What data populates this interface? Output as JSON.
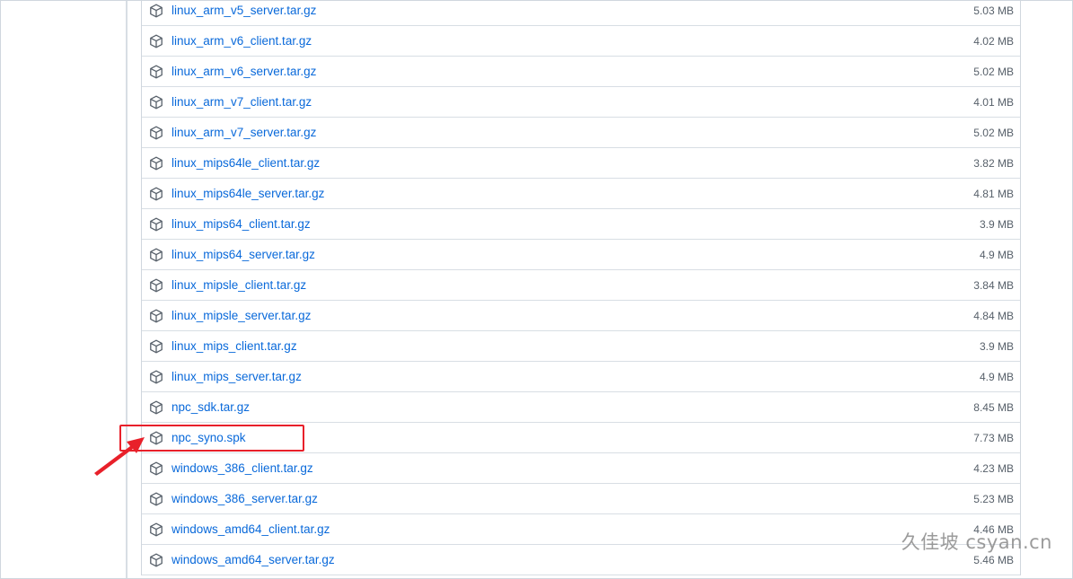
{
  "assets": [
    {
      "name": "linux_arm_v5_server.tar.gz",
      "size": "5.03 MB"
    },
    {
      "name": "linux_arm_v6_client.tar.gz",
      "size": "4.02 MB"
    },
    {
      "name": "linux_arm_v6_server.tar.gz",
      "size": "5.02 MB"
    },
    {
      "name": "linux_arm_v7_client.tar.gz",
      "size": "4.01 MB"
    },
    {
      "name": "linux_arm_v7_server.tar.gz",
      "size": "5.02 MB"
    },
    {
      "name": "linux_mips64le_client.tar.gz",
      "size": "3.82 MB"
    },
    {
      "name": "linux_mips64le_server.tar.gz",
      "size": "4.81 MB"
    },
    {
      "name": "linux_mips64_client.tar.gz",
      "size": "3.9 MB"
    },
    {
      "name": "linux_mips64_server.tar.gz",
      "size": "4.9 MB"
    },
    {
      "name": "linux_mipsle_client.tar.gz",
      "size": "3.84 MB"
    },
    {
      "name": "linux_mipsle_server.tar.gz",
      "size": "4.84 MB"
    },
    {
      "name": "linux_mips_client.tar.gz",
      "size": "3.9 MB"
    },
    {
      "name": "linux_mips_server.tar.gz",
      "size": "4.9 MB"
    },
    {
      "name": "npc_sdk.tar.gz",
      "size": "8.45 MB"
    },
    {
      "name": "npc_syno.spk",
      "size": "7.73 MB"
    },
    {
      "name": "windows_386_client.tar.gz",
      "size": "4.23 MB"
    },
    {
      "name": "windows_386_server.tar.gz",
      "size": "5.23 MB"
    },
    {
      "name": "windows_amd64_client.tar.gz",
      "size": "4.46 MB"
    },
    {
      "name": "windows_amd64_server.tar.gz",
      "size": "5.46 MB"
    }
  ],
  "icons": {
    "asset": "package-icon",
    "annotation": "arrow-icon"
  },
  "colors": {
    "link": "#0969da",
    "size_text": "#57606a",
    "highlight": "#e8202a",
    "border": "#d0d7de"
  },
  "watermark": "久佳坡 csyan.cn"
}
